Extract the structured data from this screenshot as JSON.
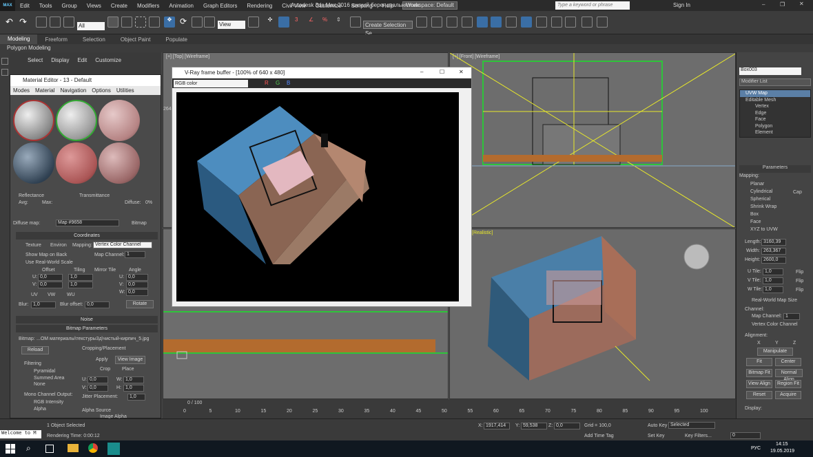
{
  "titlebar": {
    "logo": "MAX",
    "menu": [
      "Edit",
      "Tools",
      "Group",
      "Views",
      "Create",
      "Modifiers",
      "Animation",
      "Graph Editors",
      "Rendering",
      "Civil View",
      "Customize",
      "Scripting",
      "Help"
    ],
    "workspace": "Workspace: Default",
    "title": "Autodesk 3ds Max 2016     южный берег спальня.max",
    "search_placeholder": "Type a keyword or phrase",
    "signin": "Sign In"
  },
  "toolbar": {
    "selection_filter": "All",
    "ref_coord": "View",
    "selection_set": "Create Selection Se"
  },
  "ribbon": {
    "tabs": [
      "Modeling",
      "Freeform",
      "Selection",
      "Object Paint",
      "Populate"
    ],
    "active": "Modeling",
    "sub": "Polygon Modeling"
  },
  "scene_explorer": {
    "menu": [
      "Select",
      "Display",
      "Edit",
      "Customize"
    ]
  },
  "material_editor": {
    "title": "Material Editor - 13 - Default",
    "menu": [
      "Modes",
      "Material",
      "Navigation",
      "Options",
      "Utilities"
    ],
    "reflectance": "Reflectance",
    "transmittance": "Transmittance",
    "avg": "Avg:",
    "max": "Max:",
    "diffuse_label": "Diffuse:",
    "diffuse_val": "0%",
    "diffuse_map_label": "Diffuse map:",
    "map_name": "Map #9658",
    "map_type": "Bitmap",
    "coordinates": {
      "header": "Coordinates",
      "texture": "Texture",
      "environ": "Environ",
      "mapping_label": "Mapping:",
      "mapping_value": "Vertex Color Channel",
      "show_map_on_back": "Show Map on Back",
      "map_channel_label": "Map Channel:",
      "map_channel": "1",
      "use_real_world": "Use Real-World Scale",
      "offset": "Offset",
      "tiling": "Tiling",
      "mirror_tile": "Mirror Tile",
      "angle": "Angle",
      "u": "U:",
      "v": "V:",
      "w": "W:",
      "u_offset": "0,0",
      "v_offset": "0,0",
      "u_tiling": "1,0",
      "v_tiling": "1,0",
      "u_angle": "0,0",
      "v_angle": "0,0",
      "w_angle": "0,0",
      "uv": "UV",
      "vw": "VW",
      "wu": "WU",
      "blur_label": "Blur:",
      "blur": "1,0",
      "blur_offset_label": "Blur offset:",
      "blur_offset": "0,0",
      "rotate": "Rotate"
    },
    "noise": "Noise",
    "bitmap_params": {
      "header": "Bitmap Parameters",
      "bitmap_label": "Bitmap:",
      "bitmap_path": "...ОМ материалы\\текстуры3д\\чистый-кирпич_5.jpg",
      "reload": "Reload",
      "cropping": "Cropping/Placement",
      "apply": "Apply",
      "view_image": "View Image",
      "crop": "Crop",
      "place": "Place",
      "filtering": "Filtering",
      "pyramidal": "Pyramidal",
      "summed_area": "Summed Area",
      "none": "None",
      "u": "U:",
      "v": "V:",
      "w": "W:",
      "h": "H:",
      "u_val": "0,0",
      "v_val": "0,0",
      "w_val": "1,0",
      "h_val": "1,0",
      "jitter": "Jitter Placement:",
      "jitter_val": "1,0",
      "mono_channel": "Mono Channel Output:",
      "rgb_intensity": "RGB Intensity",
      "alpha": "Alpha",
      "alpha_source": "Alpha Source",
      "image_alpha": "Image Alpha"
    }
  },
  "viewports": {
    "top": "[+] [Top] [Wireframe]",
    "front": "[+] [Front] [Wireframe]",
    "perspective": "pective ] [Realistic]",
    "coord_partial": "2644"
  },
  "frame_buffer": {
    "title": "V-Ray frame buffer - [100% of 640 x 480]",
    "channel": "RGB color"
  },
  "command_panel": {
    "object_name": "Box003",
    "modifier_list": "Modifier List",
    "stack": [
      "UVW Map",
      "Editable Mesh",
      "Vertex",
      "Edge",
      "Face",
      "Polygon",
      "Element"
    ],
    "parameters": "Parameters",
    "mapping": "Mapping:",
    "mapping_options": [
      "Planar",
      "Cylindrical",
      "Spherical",
      "Shrink Wrap",
      "Box",
      "Face",
      "XYZ to UVW"
    ],
    "cap": "Cap",
    "length_label": "Length:",
    "length": "3160,39",
    "width_label": "Width:",
    "width": "263,367",
    "height_label": "Height:",
    "height": "2600,0",
    "utile_label": "U Tile:",
    "utile": "1,0",
    "vtile_label": "V Tile:",
    "vtile": "1,0",
    "wtile_label": "W Tile:",
    "wtile": "1,0",
    "flip": "Flip",
    "real_world": "Real-World Map Size",
    "channel": "Channel:",
    "map_channel": "Map Channel:",
    "map_channel_val": "1",
    "vertex_color_channel": "Vertex Color Channel",
    "alignment": "Alignment:",
    "axes": [
      "X",
      "Y",
      "Z"
    ],
    "manipulate": "Manipulate",
    "fit": "Fit",
    "center": "Center",
    "bitmap_fit": "Bitmap Fit",
    "normal_align": "Normal Align",
    "view_align": "View Align",
    "region_fit": "Region Fit",
    "reset": "Reset",
    "acquire": "Acquire",
    "display": "Display:"
  },
  "timeline": {
    "frame": "0 / 100",
    "ticks": [
      "0",
      "5",
      "10",
      "15",
      "20",
      "25",
      "30",
      "35",
      "40",
      "45",
      "50",
      "55",
      "60",
      "65",
      "70",
      "75",
      "80",
      "85",
      "90",
      "95",
      "100"
    ]
  },
  "status": {
    "listener": "Welcome to M",
    "selected": "1 Object Selected",
    "render_time": "Rendering Time: 0:00:12",
    "x_label": "X:",
    "x": "1917,414",
    "y_label": "Y:",
    "y": "59,538",
    "z_label": "Z:",
    "z": "0,0",
    "grid": "Grid = 100,0",
    "add_time_tag": "Add Time Tag",
    "auto_key": "Auto Key",
    "selected_dd": "Selected",
    "set_key": "Set Key",
    "key_filters": "Key Filters...",
    "frame_val": "0"
  },
  "taskbar": {
    "lang": "РУС",
    "time": "14:15",
    "date": "19.05.2019"
  }
}
